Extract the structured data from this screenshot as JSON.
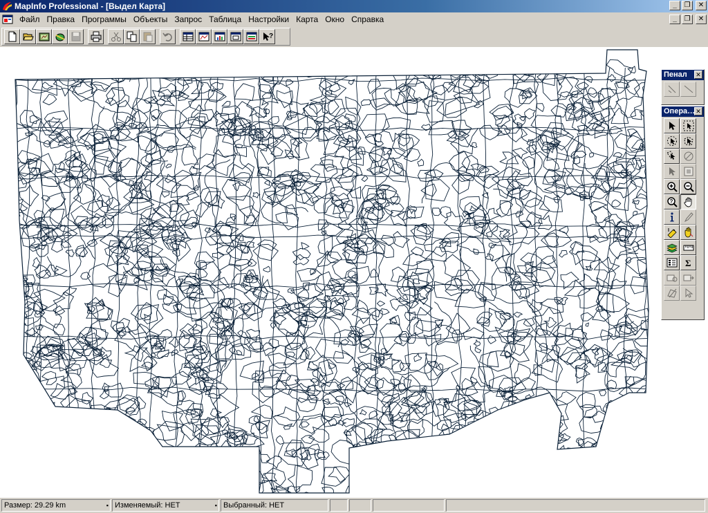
{
  "window": {
    "title": "MapInfo Professional - [Выдел Карта]"
  },
  "menu": [
    {
      "id": "file",
      "label": "Файл"
    },
    {
      "id": "edit",
      "label": "Правка"
    },
    {
      "id": "programs",
      "label": "Программы"
    },
    {
      "id": "objects",
      "label": "Объекты"
    },
    {
      "id": "query",
      "label": "Запрос"
    },
    {
      "id": "table",
      "label": "Таблица"
    },
    {
      "id": "settings",
      "label": "Настройки"
    },
    {
      "id": "map",
      "label": "Карта"
    },
    {
      "id": "window",
      "label": "Окно"
    },
    {
      "id": "help",
      "label": "Справка"
    }
  ],
  "toolbar_icons": [
    "new-icon",
    "open-icon",
    "open-workspace-icon",
    "open-dbms-icon",
    "save-icon",
    "print-icon",
    "cut-icon",
    "copy-icon",
    "paste-icon",
    "undo-icon",
    "new-browser-icon",
    "new-mapper-icon",
    "new-grapher-icon",
    "new-layout-icon",
    "redistrict-icon",
    "help-pointer-icon"
  ],
  "palettes": {
    "drawing": {
      "title": "Пенал"
    },
    "main": {
      "title": "Опера…"
    }
  },
  "main_palette_icons": [
    "select-icon",
    "marquee-select-icon",
    "radius-select-icon",
    "polygon-select-icon",
    "boundary-select-icon",
    "unselect-icon",
    "graph-select-icon",
    "layer-control-icon",
    "zoom-in-icon",
    "zoom-out-icon",
    "change-view-icon",
    "grabber-hand-icon",
    "info-icon",
    "hotlink-icon",
    "label-icon",
    "drag-map-icon",
    "layer-control-stack-icon",
    "ruler-icon",
    "legend-icon",
    "statistics-icon",
    "set-target-icon",
    "assign-target-icon",
    "show-centroid-icon",
    "clip-region-icon"
  ],
  "status": {
    "scale": "Размер: 29.29 km",
    "editable": "Изменяемый: НЕТ",
    "selected": "Выбранный: НЕТ"
  },
  "colors": {
    "map_line": "#0b2138",
    "title_active": "#0a246a"
  }
}
